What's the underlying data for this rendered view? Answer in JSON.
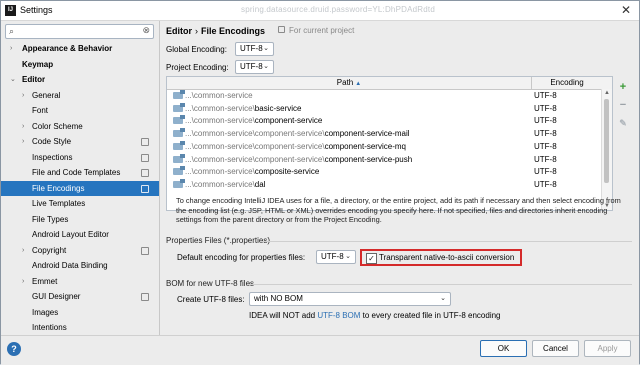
{
  "window": {
    "title": "Settings",
    "background_text": "spring.datasource.druid.password=YL:DhPDAdRdtd"
  },
  "sidebar": {
    "search_placeholder": "",
    "items": [
      {
        "label": "Appearance & Behavior",
        "arrow": "›",
        "indent": 0,
        "bold": true,
        "selected": false,
        "scope": false
      },
      {
        "label": "Keymap",
        "arrow": "",
        "indent": 0,
        "bold": true,
        "selected": false,
        "scope": false
      },
      {
        "label": "Editor",
        "arrow": "⌄",
        "indent": 0,
        "bold": true,
        "selected": false,
        "scope": false
      },
      {
        "label": "General",
        "arrow": "›",
        "indent": 1,
        "bold": false,
        "selected": false,
        "scope": false
      },
      {
        "label": "Font",
        "arrow": "",
        "indent": 1,
        "bold": false,
        "selected": false,
        "scope": false
      },
      {
        "label": "Color Scheme",
        "arrow": "›",
        "indent": 1,
        "bold": false,
        "selected": false,
        "scope": false
      },
      {
        "label": "Code Style",
        "arrow": "›",
        "indent": 1,
        "bold": false,
        "selected": false,
        "scope": true
      },
      {
        "label": "Inspections",
        "arrow": "",
        "indent": 1,
        "bold": false,
        "selected": false,
        "scope": true
      },
      {
        "label": "File and Code Templates",
        "arrow": "",
        "indent": 1,
        "bold": false,
        "selected": false,
        "scope": true
      },
      {
        "label": "File Encodings",
        "arrow": "",
        "indent": 1,
        "bold": false,
        "selected": true,
        "scope": true
      },
      {
        "label": "Live Templates",
        "arrow": "",
        "indent": 1,
        "bold": false,
        "selected": false,
        "scope": false
      },
      {
        "label": "File Types",
        "arrow": "",
        "indent": 1,
        "bold": false,
        "selected": false,
        "scope": false
      },
      {
        "label": "Android Layout Editor",
        "arrow": "",
        "indent": 1,
        "bold": false,
        "selected": false,
        "scope": false
      },
      {
        "label": "Copyright",
        "arrow": "›",
        "indent": 1,
        "bold": false,
        "selected": false,
        "scope": true
      },
      {
        "label": "Android Data Binding",
        "arrow": "",
        "indent": 1,
        "bold": false,
        "selected": false,
        "scope": false
      },
      {
        "label": "Emmet",
        "arrow": "›",
        "indent": 1,
        "bold": false,
        "selected": false,
        "scope": false
      },
      {
        "label": "GUI Designer",
        "arrow": "",
        "indent": 1,
        "bold": false,
        "selected": false,
        "scope": true
      },
      {
        "label": "Images",
        "arrow": "",
        "indent": 1,
        "bold": false,
        "selected": false,
        "scope": false
      },
      {
        "label": "Intentions",
        "arrow": "",
        "indent": 1,
        "bold": false,
        "selected": false,
        "scope": false
      }
    ]
  },
  "main": {
    "breadcrumb": {
      "parent": "Editor",
      "separator": "›",
      "current": "File Encodings"
    },
    "for_current_project": "For current project",
    "global_encoding": {
      "label": "Global Encoding:",
      "value": "UTF-8"
    },
    "project_encoding": {
      "label": "Project Encoding:",
      "value": "UTF-8"
    },
    "table": {
      "columns": [
        "Path",
        "Encoding"
      ],
      "rows": [
        {
          "prefix": "...\\common-service",
          "suffix": "",
          "encoding": "UTF-8"
        },
        {
          "prefix": "...\\common-service\\",
          "suffix": "basic-service",
          "encoding": "UTF-8"
        },
        {
          "prefix": "...\\common-service\\",
          "suffix": "component-service",
          "encoding": "UTF-8"
        },
        {
          "prefix": "...\\common-service\\component-service\\",
          "suffix": "component-service-mail",
          "encoding": "UTF-8"
        },
        {
          "prefix": "...\\common-service\\component-service\\",
          "suffix": "component-service-mq",
          "encoding": "UTF-8"
        },
        {
          "prefix": "...\\common-service\\component-service\\",
          "suffix": "component-service-push",
          "encoding": "UTF-8"
        },
        {
          "prefix": "...\\common-service\\",
          "suffix": "composite-service",
          "encoding": "UTF-8"
        },
        {
          "prefix": "...\\common-service\\",
          "suffix": "dal",
          "encoding": "UTF-8"
        }
      ]
    },
    "description": "To change encoding IntelliJ IDEA uses for a file, a directory, or the entire project, add its path if necessary and then select encoding from the encoding list (e.g. JSP, HTML or XML) overrides encoding you specify here. If not specified, files and directories inherit encoding settings from the parent directory or from the Project Encoding.",
    "properties": {
      "section_title": "Properties Files (*.properties)",
      "default_label": "Default encoding for properties files:",
      "default_value": "UTF-8",
      "transparent_label": "Transparent native-to-ascii conversion",
      "transparent_checked": "✓"
    },
    "bom": {
      "section_title": "BOM for new UTF-8 files",
      "create_label": "Create UTF-8 files:",
      "create_value": "with NO BOM",
      "note_before": "IDEA will NOT add ",
      "note_link": "UTF-8 BOM",
      "note_after": " to every created file in UTF-8 encoding"
    }
  },
  "footer": {
    "help": "?",
    "ok": "OK",
    "cancel": "Cancel",
    "apply": "Apply"
  }
}
